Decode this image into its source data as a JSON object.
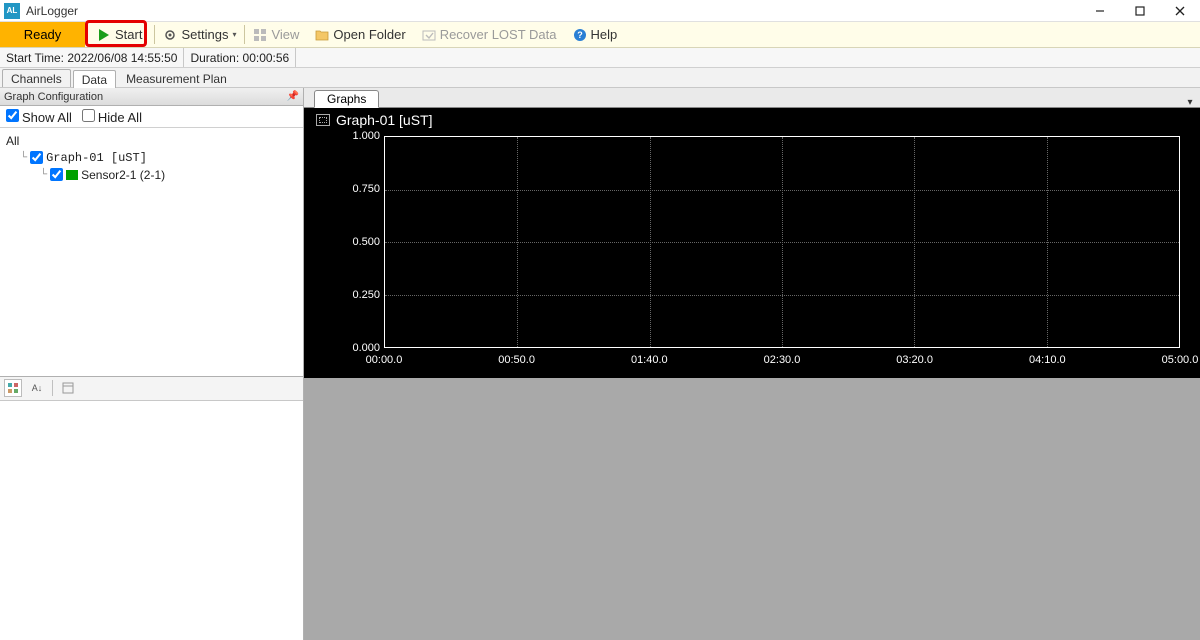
{
  "app": {
    "title": "AirLogger"
  },
  "toolbar": {
    "status": "Ready",
    "start": "Start",
    "settings": "Settings",
    "view": "View",
    "open_folder": "Open Folder",
    "recover": "Recover LOST Data",
    "help": "Help"
  },
  "infobar": {
    "start_time_label": "Start Time:",
    "start_time_value": "2022/06/08 14:55:50",
    "duration_label": "Duration:",
    "duration_value": "00:00:56"
  },
  "tabs": {
    "channels": "Channels",
    "data": "Data",
    "measurement_plan": "Measurement Plan"
  },
  "left": {
    "header": "Graph Configuration",
    "show_all": "Show All",
    "hide_all": "Hide All",
    "tree_root": "All",
    "graph_node": "Graph-01 [uST]",
    "sensor_node": "Sensor2-1 (2-1)"
  },
  "graph_tab": "Graphs",
  "graph_title": "Graph-01 [uST]",
  "chart_data": {
    "type": "line",
    "title": "Graph-01 [uST]",
    "xlabel": "",
    "ylabel": "",
    "ylim": [
      0,
      1.0
    ],
    "y_ticks": [
      0.0,
      0.25,
      0.5,
      0.75,
      1.0
    ],
    "x_ticks": [
      "00:00.0",
      "00:50.0",
      "01:40.0",
      "02:30.0",
      "03:20.0",
      "04:10.0",
      "05:00.0"
    ],
    "series": [
      {
        "name": "Sensor2-1 (2-1)",
        "color": "#00a000",
        "values": []
      }
    ]
  }
}
